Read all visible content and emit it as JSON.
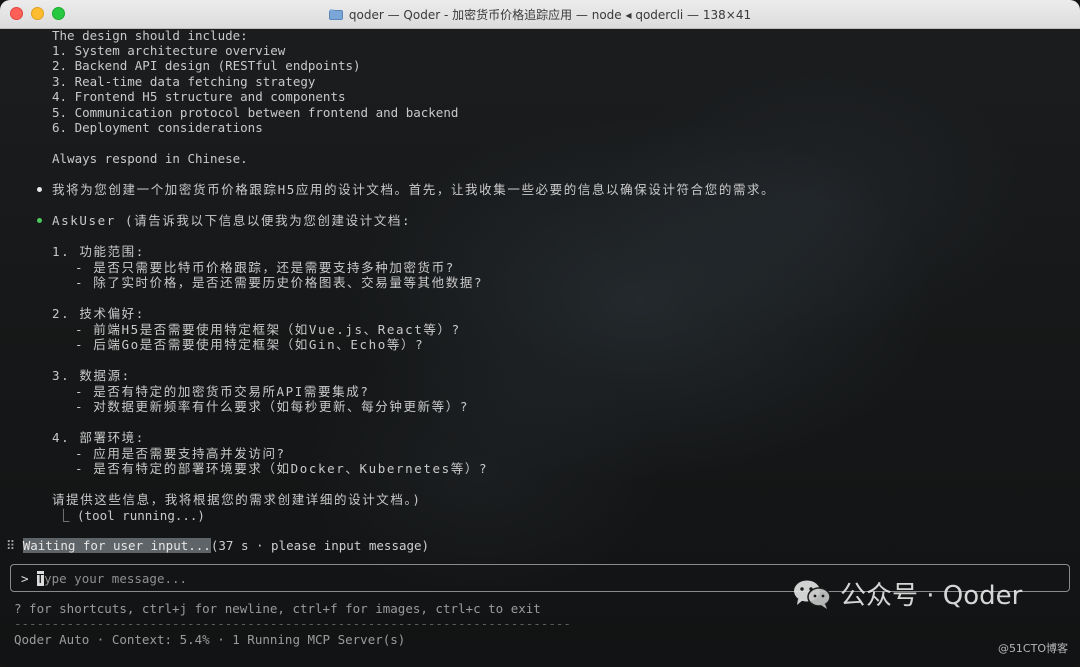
{
  "window": {
    "title": "qoder — Qoder - 加密货币价格追踪应用 — node ◂ qodercli — 138×41"
  },
  "terminal": {
    "design_intro": "The design should include:",
    "design_items": [
      "1. System architecture overview",
      "2. Backend API design (RESTful endpoints)",
      "3. Real-time data fetching strategy",
      "4. Frontend H5 structure and components",
      "5. Communication protocol between frontend and backend",
      "6. Deployment considerations"
    ],
    "respond_note": "Always respond in Chinese.",
    "assistant_message": "我将为您创建一个加密货币价格跟踪H5应用的设计文档。首先，让我收集一些必要的信息以确保设计符合您的需求。",
    "askuser_line": "AskUser (请告诉我以下信息以便我为您创建设计文档:",
    "sections": [
      {
        "heading": "1. 功能范围:",
        "items": [
          "- 是否只需要比特币价格跟踪，还是需要支持多种加密货币?",
          "- 除了实时价格，是否还需要历史价格图表、交易量等其他数据?"
        ]
      },
      {
        "heading": "2. 技术偏好:",
        "items": [
          "- 前端H5是否需要使用特定框架（如Vue.js、React等）?",
          "- 后端Go是否需要使用特定框架（如Gin、Echo等）?"
        ]
      },
      {
        "heading": "3. 数据源:",
        "items": [
          "- 是否有特定的加密货币交易所API需要集成?",
          "- 对数据更新频率有什么要求（如每秒更新、每分钟更新等）?"
        ]
      },
      {
        "heading": "4. 部署环境:",
        "items": [
          "- 应用是否需要支持高并发访问?",
          "- 是否有特定的部署环境要求（如Docker、Kubernetes等）?"
        ]
      }
    ],
    "closing": "请提供这些信息，我将根据您的需求创建详细的设计文档。)",
    "tool_running": "⎿ (tool running...)",
    "status_spinner": "⠿",
    "status_highlight": "Waiting for user input...",
    "status_rest": "(37 s · please input message)",
    "input": {
      "prompt": ">",
      "cursor_char": "T",
      "placeholder": "ype your message..."
    },
    "shortcuts_hint": "? for shortcuts, ctrl+j for newline, ctrl+f for images, ctrl+c to exit",
    "separator": "--------------------------------------------------------------------------",
    "status_bar": "Qoder Auto · Context: 5.4% · 1 Running MCP Server(s)"
  },
  "watermark": {
    "text": "公众号 · Qoder",
    "sub": "@51CTO博客"
  },
  "colors": {
    "green_bullet": "#4cc95a",
    "highlight_bg": "#5f6468"
  }
}
